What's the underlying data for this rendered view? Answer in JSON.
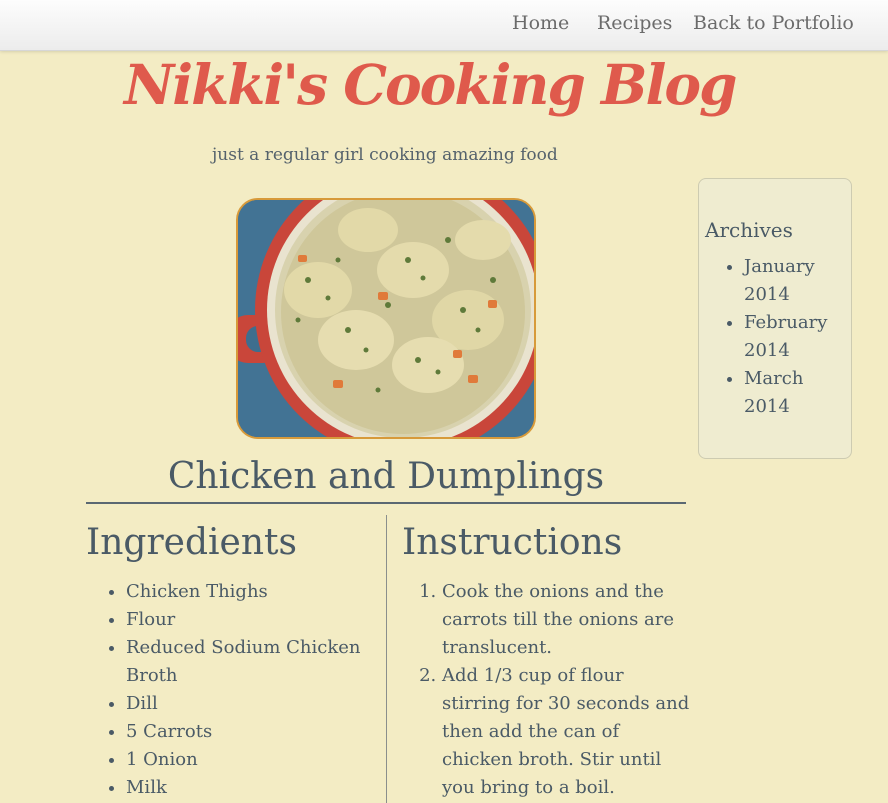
{
  "nav": {
    "links": [
      "Home",
      "Recipes",
      "Back to Portfolio"
    ]
  },
  "header": {
    "title": "Nikki's Cooking Blog",
    "tagline": "just a regular girl cooking amazing food"
  },
  "sidebar": {
    "heading": "Archives",
    "items": [
      "January 2014",
      "February 2014",
      "March 2014"
    ]
  },
  "post": {
    "title": "Chicken and Dumplings",
    "ingredients_heading": "Ingredients",
    "ingredients": [
      "Chicken Thighs",
      "Flour",
      "Reduced Sodium Chicken Broth",
      "Dill",
      "5 Carrots",
      "1 Onion",
      "Milk"
    ],
    "instructions_heading": "Instructions",
    "instructions": [
      "Cook the onions and the carrots till the onions are translucent.",
      "Add 1/3 cup of flour stirring for 30 seconds and then add the can of chicken broth. Stir until you bring to a boil."
    ]
  },
  "colors": {
    "background": "#f3ecc4",
    "title_red": "#df5a4c",
    "text": "#4a5a66",
    "image_border": "#d79a3a"
  }
}
